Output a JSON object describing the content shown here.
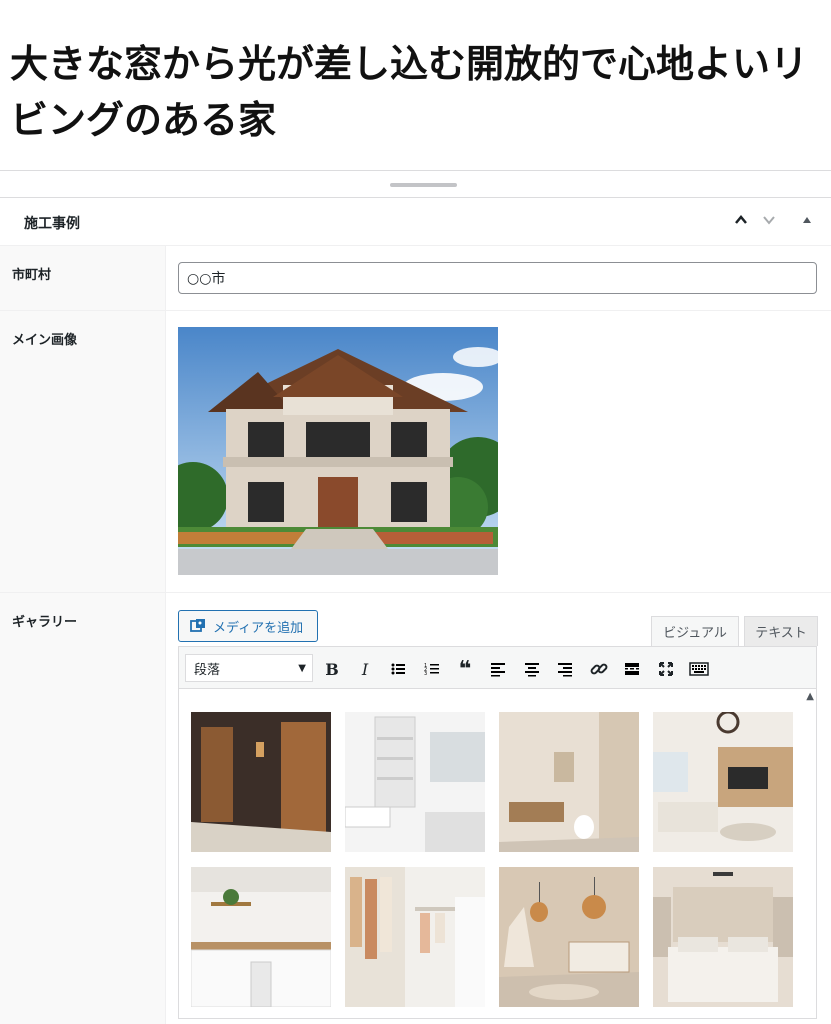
{
  "post_title": "大きな窓から光が差し込む開放的で心地よいリビングのある家",
  "metabox": {
    "title": "施工事例",
    "controls": [
      "move-up",
      "move-down",
      "toggle"
    ]
  },
  "fields": {
    "city": {
      "label": "市町村",
      "value": "○○市"
    },
    "main_image": {
      "label": "メイン画像"
    },
    "gallery": {
      "label": "ギャラリー",
      "add_media_label": "メディアを追加",
      "tab_visual": "ビジュアル",
      "tab_text": "テキスト",
      "format_value": "段落",
      "toolbar": [
        "bold",
        "italic",
        "bullet-list",
        "numbered-list",
        "blockquote",
        "align-left",
        "align-center",
        "align-right",
        "link",
        "read-more",
        "fullscreen",
        "toolbar-toggle"
      ]
    }
  },
  "toolbar_glyphs": {
    "bold": "B",
    "italic": "I",
    "bullet": "☰",
    "numbered": "☷",
    "quote": "❝",
    "left": "≡",
    "center": "≡",
    "right": "≡",
    "link": "⛓",
    "more": "▬",
    "full": "✕",
    "kbd": "⌨"
  }
}
